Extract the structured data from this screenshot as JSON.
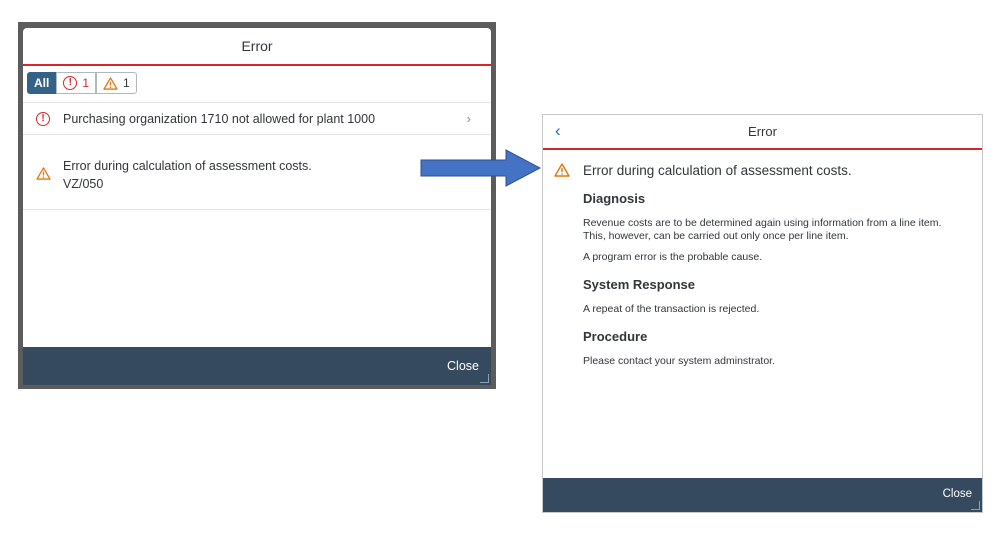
{
  "left_dialog": {
    "title": "Error",
    "filters": {
      "all_label": "All",
      "error_count": "1",
      "warning_count": "1"
    },
    "messages": [
      {
        "type": "error-icon",
        "text": "Purchasing organization 1710 not allowed for plant 1000"
      },
      {
        "type": "warning-icon",
        "text": "Error during calculation of assessment costs.",
        "subtext": "VZ/050"
      }
    ],
    "footer": {
      "close_label": "Close"
    }
  },
  "right_dialog": {
    "title": "Error",
    "message_title": "Error during calculation of assessment costs.",
    "sections": {
      "diagnosis_heading": "Diagnosis",
      "diagnosis_p1": "Revenue costs are to be determined again using information from a line item. This, however, can be carried out only once per line item.",
      "diagnosis_p2": "A program error is the probable cause.",
      "response_heading": "System Response",
      "response_p1": "A repeat of the transaction is rejected.",
      "procedure_heading": "Procedure",
      "procedure_p1": "Please contact your system adminstrator."
    },
    "footer": {
      "close_label": "Close"
    }
  },
  "colors": {
    "error": "#d7262a",
    "warning": "#e9730c",
    "footer_bg": "#354a5f",
    "segment_active": "#346187",
    "arrow": "#4472c4"
  }
}
